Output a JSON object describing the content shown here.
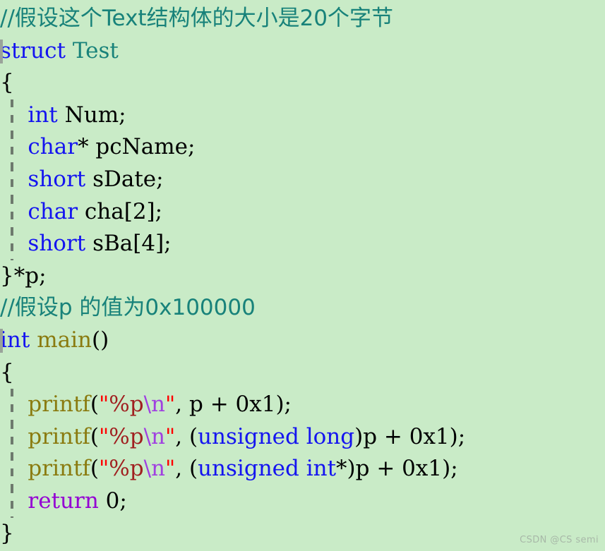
{
  "editor": {
    "background_color": "#c9ebc7",
    "language": "C",
    "comment_color": "#18827a",
    "keyword_color": "#1414f0",
    "function_color": "#8a7b10",
    "string_color": "#a02020",
    "quote_color": "#ff0000",
    "escape_color": "#a040e0",
    "return_color": "#9400d3",
    "plain_color": "#000000",
    "indent_guide_color": "#6e7a6e",
    "fold_bar_color": "#9aa39a"
  },
  "code": {
    "lines": [
      {
        "n": 1,
        "fold_bar": false,
        "indent_guide": false,
        "tokens": [
          {
            "t": "//假设这个Text结构体的大小是20个字节",
            "c": "tok-comment"
          }
        ]
      },
      {
        "n": 2,
        "fold_bar": true,
        "indent_guide": false,
        "tokens": [
          {
            "t": "struct",
            "c": "tok-keyword"
          },
          {
            "t": " ",
            "c": "tok-plain"
          },
          {
            "t": "Test",
            "c": "tok-type"
          }
        ]
      },
      {
        "n": 3,
        "fold_bar": false,
        "indent_guide": false,
        "tokens": [
          {
            "t": "{",
            "c": "tok-plain"
          }
        ]
      },
      {
        "n": 4,
        "fold_bar": false,
        "indent_guide": true,
        "tokens": [
          {
            "t": "    ",
            "c": "tok-plain"
          },
          {
            "t": "int",
            "c": "tok-keyword"
          },
          {
            "t": " Num;",
            "c": "tok-plain"
          }
        ]
      },
      {
        "n": 5,
        "fold_bar": false,
        "indent_guide": true,
        "tokens": [
          {
            "t": "    ",
            "c": "tok-plain"
          },
          {
            "t": "char",
            "c": "tok-keyword"
          },
          {
            "t": "* pcName;",
            "c": "tok-plain"
          }
        ]
      },
      {
        "n": 6,
        "fold_bar": false,
        "indent_guide": true,
        "tokens": [
          {
            "t": "    ",
            "c": "tok-plain"
          },
          {
            "t": "short",
            "c": "tok-keyword"
          },
          {
            "t": " sDate;",
            "c": "tok-plain"
          }
        ]
      },
      {
        "n": 7,
        "fold_bar": false,
        "indent_guide": true,
        "tokens": [
          {
            "t": "    ",
            "c": "tok-plain"
          },
          {
            "t": "char",
            "c": "tok-keyword"
          },
          {
            "t": " cha[2];",
            "c": "tok-plain"
          }
        ]
      },
      {
        "n": 8,
        "fold_bar": false,
        "indent_guide": true,
        "tokens": [
          {
            "t": "    ",
            "c": "tok-plain"
          },
          {
            "t": "short",
            "c": "tok-keyword"
          },
          {
            "t": " sBa[4];",
            "c": "tok-plain"
          }
        ]
      },
      {
        "n": 9,
        "fold_bar": false,
        "indent_guide": false,
        "tokens": [
          {
            "t": "}*p;",
            "c": "tok-plain"
          }
        ]
      },
      {
        "n": 10,
        "fold_bar": false,
        "indent_guide": false,
        "tokens": [
          {
            "t": "//假设p 的值为0x100000",
            "c": "tok-comment"
          }
        ]
      },
      {
        "n": 11,
        "fold_bar": true,
        "indent_guide": false,
        "tokens": [
          {
            "t": "int",
            "c": "tok-keyword"
          },
          {
            "t": " ",
            "c": "tok-plain"
          },
          {
            "t": "main",
            "c": "tok-func"
          },
          {
            "t": "()",
            "c": "tok-plain"
          }
        ]
      },
      {
        "n": 12,
        "fold_bar": false,
        "indent_guide": false,
        "tokens": [
          {
            "t": "{",
            "c": "tok-plain"
          }
        ]
      },
      {
        "n": 13,
        "fold_bar": false,
        "indent_guide": true,
        "tokens": [
          {
            "t": "    ",
            "c": "tok-plain"
          },
          {
            "t": "printf",
            "c": "tok-func"
          },
          {
            "t": "(",
            "c": "tok-plain"
          },
          {
            "t": "\"",
            "c": "tok-quote"
          },
          {
            "t": "%p",
            "c": "tok-string"
          },
          {
            "t": "\\n",
            "c": "tok-escape"
          },
          {
            "t": "\"",
            "c": "tok-quote"
          },
          {
            "t": ", p + 0x1);",
            "c": "tok-plain"
          }
        ]
      },
      {
        "n": 14,
        "fold_bar": false,
        "indent_guide": true,
        "tokens": [
          {
            "t": "    ",
            "c": "tok-plain"
          },
          {
            "t": "printf",
            "c": "tok-func"
          },
          {
            "t": "(",
            "c": "tok-plain"
          },
          {
            "t": "\"",
            "c": "tok-quote"
          },
          {
            "t": "%p",
            "c": "tok-string"
          },
          {
            "t": "\\n",
            "c": "tok-escape"
          },
          {
            "t": "\"",
            "c": "tok-quote"
          },
          {
            "t": ", (",
            "c": "tok-plain"
          },
          {
            "t": "unsigned long",
            "c": "tok-keyword"
          },
          {
            "t": ")p + 0x1);",
            "c": "tok-plain"
          }
        ]
      },
      {
        "n": 15,
        "fold_bar": false,
        "indent_guide": true,
        "tokens": [
          {
            "t": "    ",
            "c": "tok-plain"
          },
          {
            "t": "printf",
            "c": "tok-func"
          },
          {
            "t": "(",
            "c": "tok-plain"
          },
          {
            "t": "\"",
            "c": "tok-quote"
          },
          {
            "t": "%p",
            "c": "tok-string"
          },
          {
            "t": "\\n",
            "c": "tok-escape"
          },
          {
            "t": "\"",
            "c": "tok-quote"
          },
          {
            "t": ", (",
            "c": "tok-plain"
          },
          {
            "t": "unsigned int",
            "c": "tok-keyword"
          },
          {
            "t": "*)p + 0x1);",
            "c": "tok-plain"
          }
        ]
      },
      {
        "n": 16,
        "fold_bar": false,
        "indent_guide": true,
        "tokens": [
          {
            "t": "    ",
            "c": "tok-plain"
          },
          {
            "t": "return",
            "c": "tok-return"
          },
          {
            "t": " 0;",
            "c": "tok-plain"
          }
        ]
      },
      {
        "n": 17,
        "fold_bar": false,
        "indent_guide": false,
        "tokens": [
          {
            "t": "}",
            "c": "tok-plain"
          }
        ]
      }
    ]
  },
  "watermark": {
    "text": "CSDN @CS semi"
  }
}
